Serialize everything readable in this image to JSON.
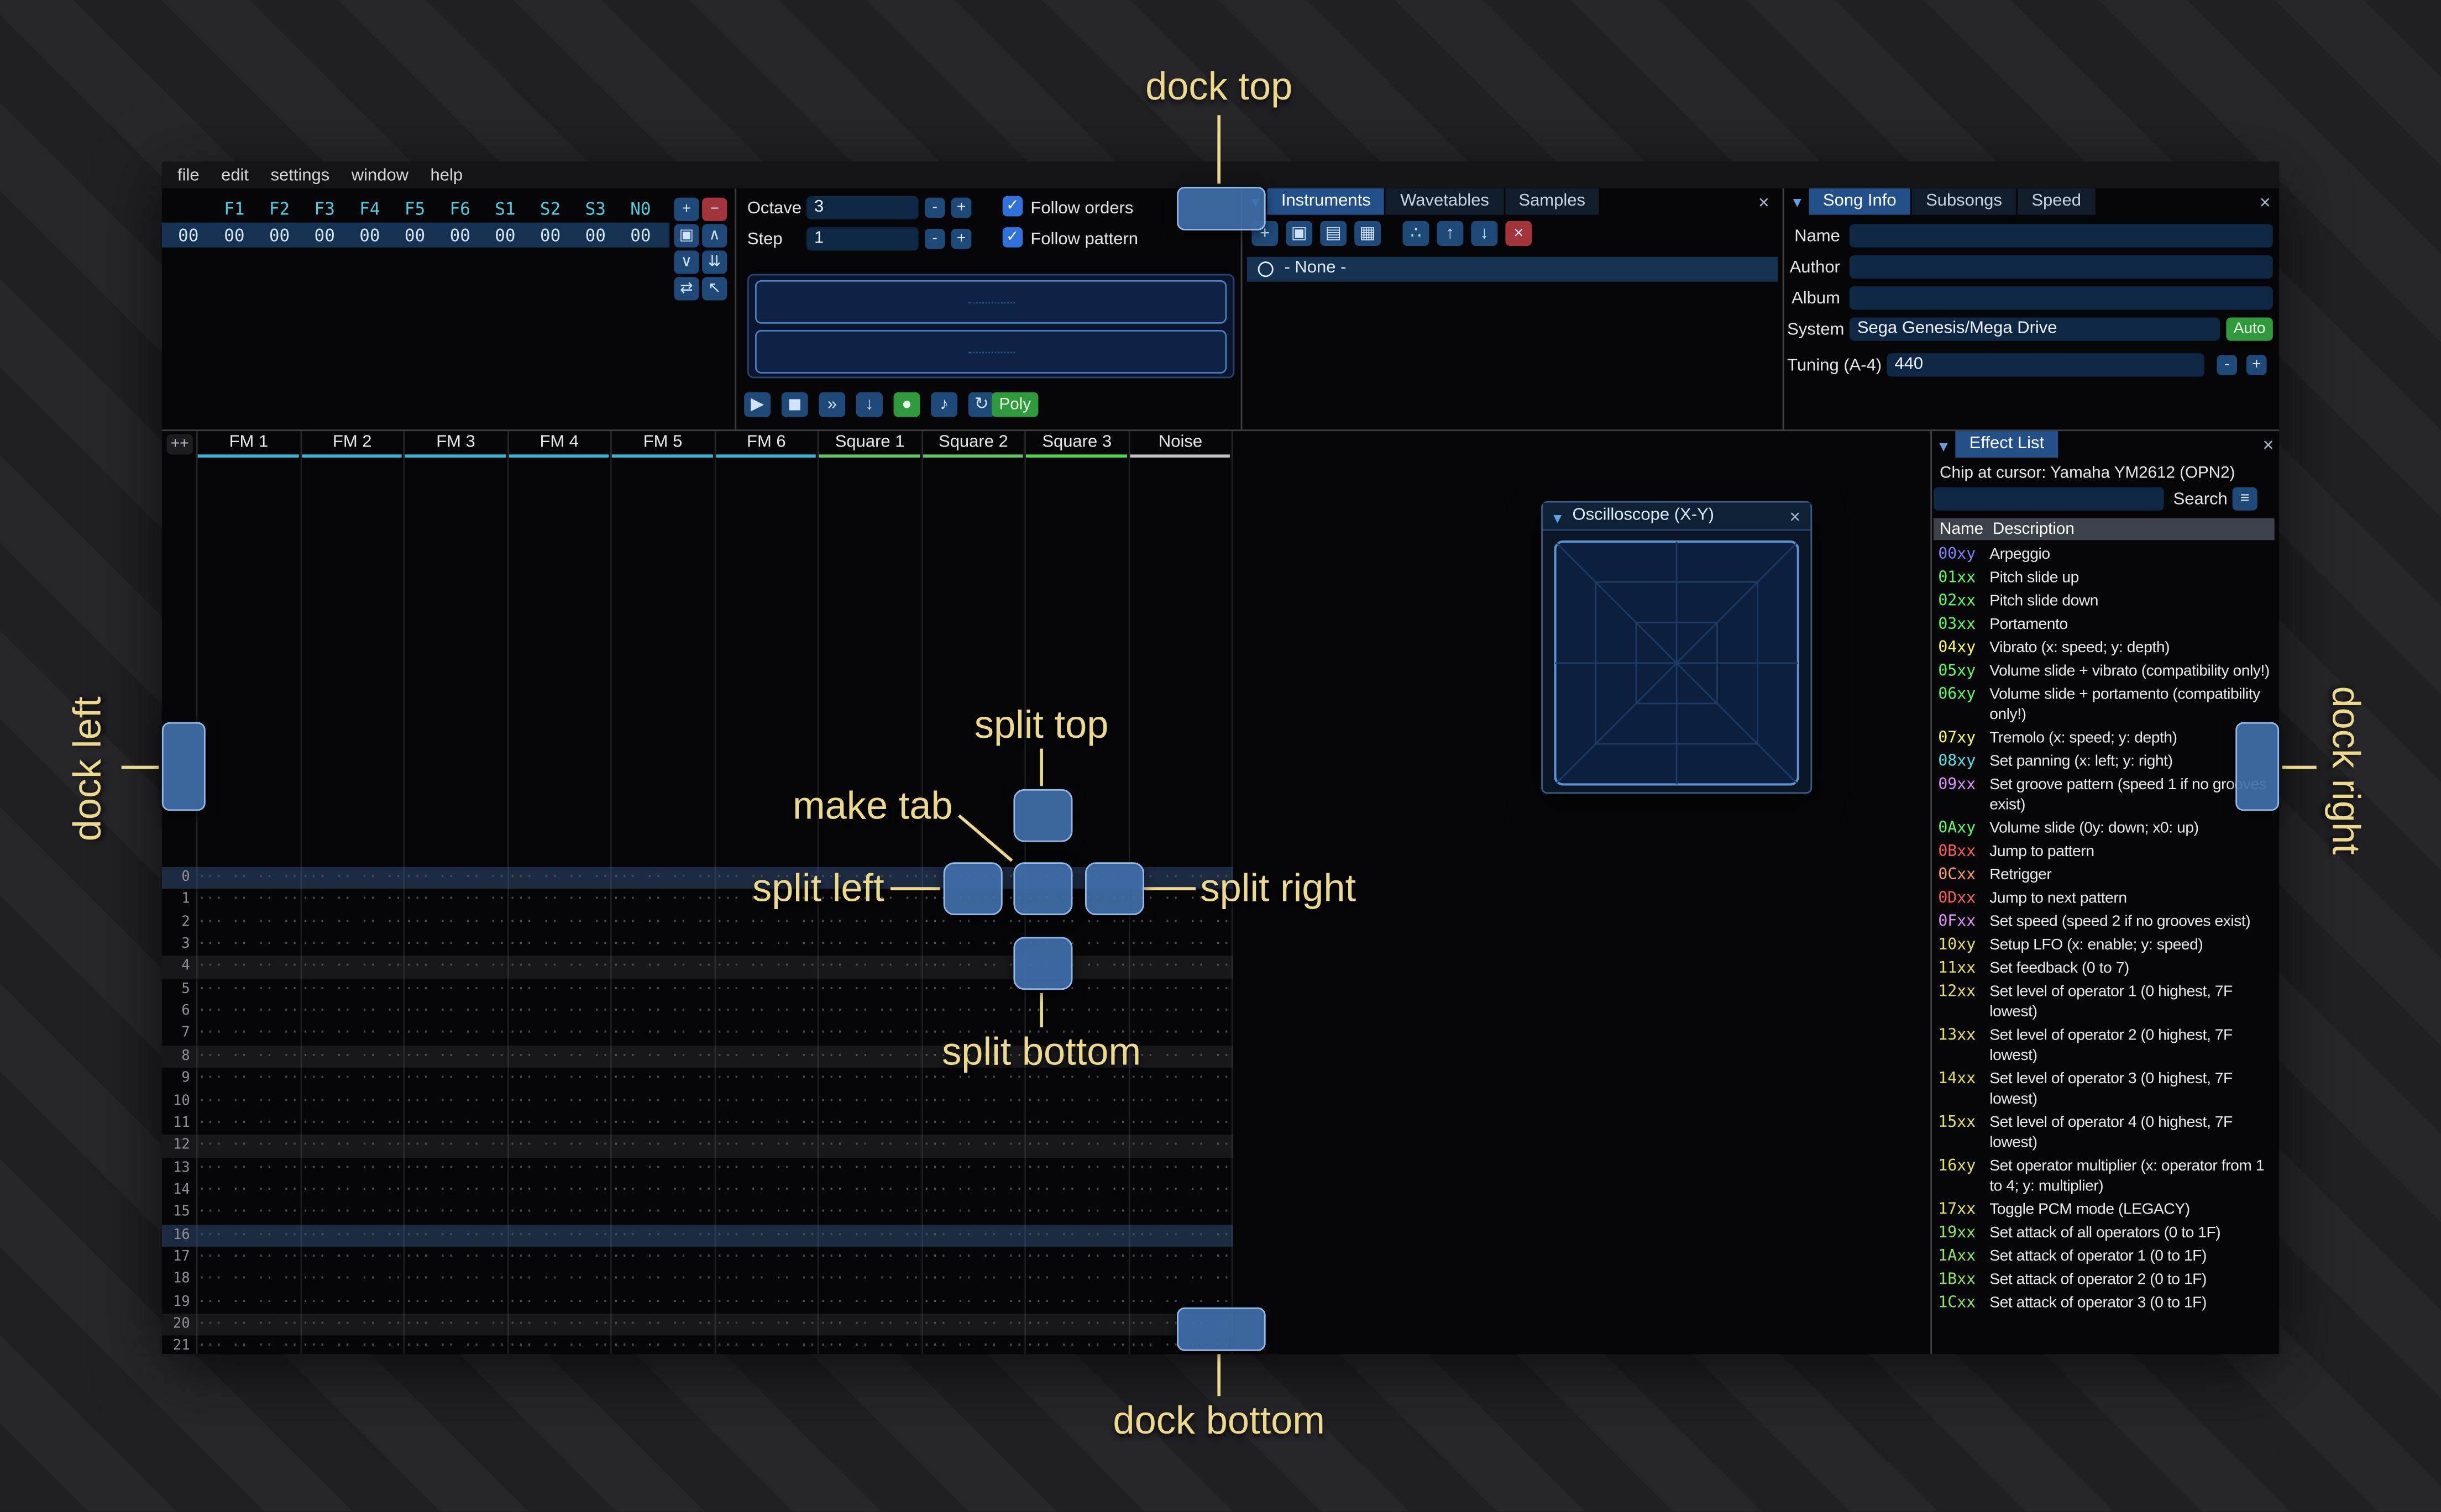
{
  "icons": {
    "close": "×",
    "collapse": "▼",
    "check": "✓",
    "menu": "≡",
    "tab_arrow": "▼"
  },
  "menu": {
    "items": [
      "file",
      "edit",
      "settings",
      "window",
      "help"
    ]
  },
  "orders": {
    "channels": [
      "F1",
      "F2",
      "F3",
      "F4",
      "F5",
      "F6",
      "S1",
      "S2",
      "S3",
      "N0"
    ],
    "rows": [
      {
        "index": "00",
        "cells": [
          "00",
          "00",
          "00",
          "00",
          "00",
          "00",
          "00",
          "00",
          "00",
          "00"
        ],
        "selected": true
      }
    ],
    "buttons": [
      {
        "name": "add",
        "glyph": "+"
      },
      {
        "name": "remove",
        "glyph": "−",
        "style": "red"
      },
      {
        "name": "duplicate",
        "glyph": "▣"
      },
      {
        "name": "move-up",
        "glyph": "∧"
      },
      {
        "name": "move-down",
        "glyph": "∨"
      },
      {
        "name": "duplicate-to-end",
        "glyph": "⇊"
      },
      {
        "name": "change-all",
        "glyph": "⇄"
      },
      {
        "name": "edit-mode",
        "glyph": "↖"
      }
    ]
  },
  "play": {
    "octave_label": "Octave",
    "octave_value": "3",
    "step_label": "Step",
    "step_value": "1",
    "minus": "-",
    "plus": "+",
    "follow_orders": "Follow orders",
    "follow_pattern": "Follow pattern",
    "transport": [
      {
        "name": "play",
        "glyph": "▶"
      },
      {
        "name": "stop",
        "glyph": "◼"
      },
      {
        "name": "play-from-beginning",
        "glyph": "»"
      },
      {
        "name": "step-one-row",
        "glyph": "↓"
      },
      {
        "name": "edit-record",
        "glyph": "●",
        "style": "green"
      },
      {
        "name": "metronome",
        "glyph": "♪"
      },
      {
        "name": "repeat-pattern",
        "glyph": "↻"
      }
    ],
    "poly_label": "Poly"
  },
  "instruments": {
    "tabs": [
      "Instruments",
      "Wavetables",
      "Samples"
    ],
    "toolbar": [
      {
        "name": "add",
        "glyph": "+"
      },
      {
        "name": "duplicate",
        "glyph": "▣"
      },
      {
        "name": "open",
        "glyph": "▤"
      },
      {
        "name": "save",
        "glyph": "▦"
      },
      {
        "name": "toggle-folders",
        "glyph": "∴"
      },
      {
        "name": "move-up",
        "glyph": "↑"
      },
      {
        "name": "move-down",
        "glyph": "↓"
      },
      {
        "name": "delete",
        "glyph": "×",
        "style": "red"
      }
    ],
    "list_none_label": "- None -"
  },
  "song_info": {
    "tabs": [
      "Song Info",
      "Subsongs",
      "Speed"
    ],
    "name_label": "Name",
    "name_value": "",
    "author_label": "Author",
    "author_value": "",
    "album_label": "Album",
    "album_value": "",
    "system_label": "System",
    "system_value": "Sega Genesis/Mega Drive",
    "auto_label": "Auto",
    "tuning_label": "Tuning (A-4)",
    "tuning_value": "440"
  },
  "pattern": {
    "expand_label": "++",
    "channels": [
      {
        "name": "FM 1",
        "color": "#35b5d8"
      },
      {
        "name": "FM 2",
        "color": "#35b5d8"
      },
      {
        "name": "FM 3",
        "color": "#35b5d8"
      },
      {
        "name": "FM 4",
        "color": "#35b5d8"
      },
      {
        "name": "FM 5",
        "color": "#35b5d8"
      },
      {
        "name": "FM 6",
        "color": "#35b5d8"
      },
      {
        "name": "Square 1",
        "color": "#62c462"
      },
      {
        "name": "Square 2",
        "color": "#62c462"
      },
      {
        "name": "Square 3",
        "color": "#49d849"
      },
      {
        "name": "Noise",
        "color": "#bfbfbf"
      }
    ],
    "row_count": 22,
    "empty_cell": "··· ·· ·· ···",
    "major_rows": [
      0,
      16
    ],
    "minor_rows": [
      4,
      8,
      12,
      20
    ]
  },
  "oscilloscope": {
    "title": "Oscilloscope (X-Y)"
  },
  "effects": {
    "title": "Effect List",
    "chip": "Chip at cursor: Yamaha YM2612 (OPN2)",
    "search_value": "",
    "search_label": "Search",
    "name_header": "Name",
    "desc_header": "Description",
    "rows": [
      {
        "code": "00xy",
        "color": "#7f7fff",
        "desc": "Arpeggio"
      },
      {
        "code": "01xx",
        "color": "#59ff59",
        "desc": "Pitch slide up"
      },
      {
        "code": "02xx",
        "color": "#59ff59",
        "desc": "Pitch slide down"
      },
      {
        "code": "03xx",
        "color": "#59ff59",
        "desc": "Portamento"
      },
      {
        "code": "04xy",
        "color": "#ffff59",
        "desc": "Vibrato (x: speed; y: depth)"
      },
      {
        "code": "05xy",
        "color": "#59ff59",
        "desc": "Volume slide + vibrato (compatibility only!)"
      },
      {
        "code": "06xy",
        "color": "#59ff59",
        "desc": "Volume slide + portamento (compatibility only!)"
      },
      {
        "code": "07xy",
        "color": "#ffff59",
        "desc": "Tremolo (x: speed; y: depth)"
      },
      {
        "code": "08xy",
        "color": "#53e4e4",
        "desc": "Set panning (x: left; y: right)"
      },
      {
        "code": "09xx",
        "color": "#e08fff",
        "desc": "Set groove pattern (speed 1 if no grooves exist)"
      },
      {
        "code": "0Axy",
        "color": "#59ff59",
        "desc": "Volume slide (0y: down; x0: up)"
      },
      {
        "code": "0Bxx",
        "color": "#ff5959",
        "desc": "Jump to pattern"
      },
      {
        "code": "0Cxx",
        "color": "#ff9e59",
        "desc": "Retrigger"
      },
      {
        "code": "0Dxx",
        "color": "#ff5959",
        "desc": "Jump to next pattern"
      },
      {
        "code": "0Fxx",
        "color": "#e08fff",
        "desc": "Set speed (speed 2 if no grooves exist)"
      },
      {
        "code": "10xy",
        "color": "#e6e05a",
        "desc": "Setup LFO (x: enable; y: speed)"
      },
      {
        "code": "11xx",
        "color": "#e6e05a",
        "desc": "Set feedback (0 to 7)"
      },
      {
        "code": "12xx",
        "color": "#e6e05a",
        "desc": "Set level of operator 1 (0 highest, 7F lowest)"
      },
      {
        "code": "13xx",
        "color": "#e6e05a",
        "desc": "Set level of operator 2 (0 highest, 7F lowest)"
      },
      {
        "code": "14xx",
        "color": "#e6e05a",
        "desc": "Set level of operator 3 (0 highest, 7F lowest)"
      },
      {
        "code": "15xx",
        "color": "#e6e05a",
        "desc": "Set level of operator 4 (0 highest, 7F lowest)"
      },
      {
        "code": "16xy",
        "color": "#e6e05a",
        "desc": "Set operator multiplier (x: operator from 1 to 4; y: multiplier)"
      },
      {
        "code": "17xx",
        "color": "#e6e05a",
        "desc": "Toggle PCM mode (LEGACY)"
      },
      {
        "code": "19xx",
        "color": "#8fe659",
        "desc": "Set attack of all operators (0 to 1F)"
      },
      {
        "code": "1Axx",
        "color": "#8fe659",
        "desc": "Set attack of operator 1 (0 to 1F)"
      },
      {
        "code": "1Bxx",
        "color": "#8fe659",
        "desc": "Set attack of operator 2 (0 to 1F)"
      },
      {
        "code": "1Cxx",
        "color": "#8fe659",
        "desc": "Set attack of operator 3 (0 to 1F)"
      }
    ]
  },
  "overlay": {
    "dock_top": "dock top",
    "dock_bottom": "dock bottom",
    "dock_left": "dock left",
    "dock_right": "dock right",
    "split_top": "split top",
    "split_bottom": "split bottom",
    "split_left": "split left",
    "split_right": "split right",
    "make_tab": "make tab"
  }
}
